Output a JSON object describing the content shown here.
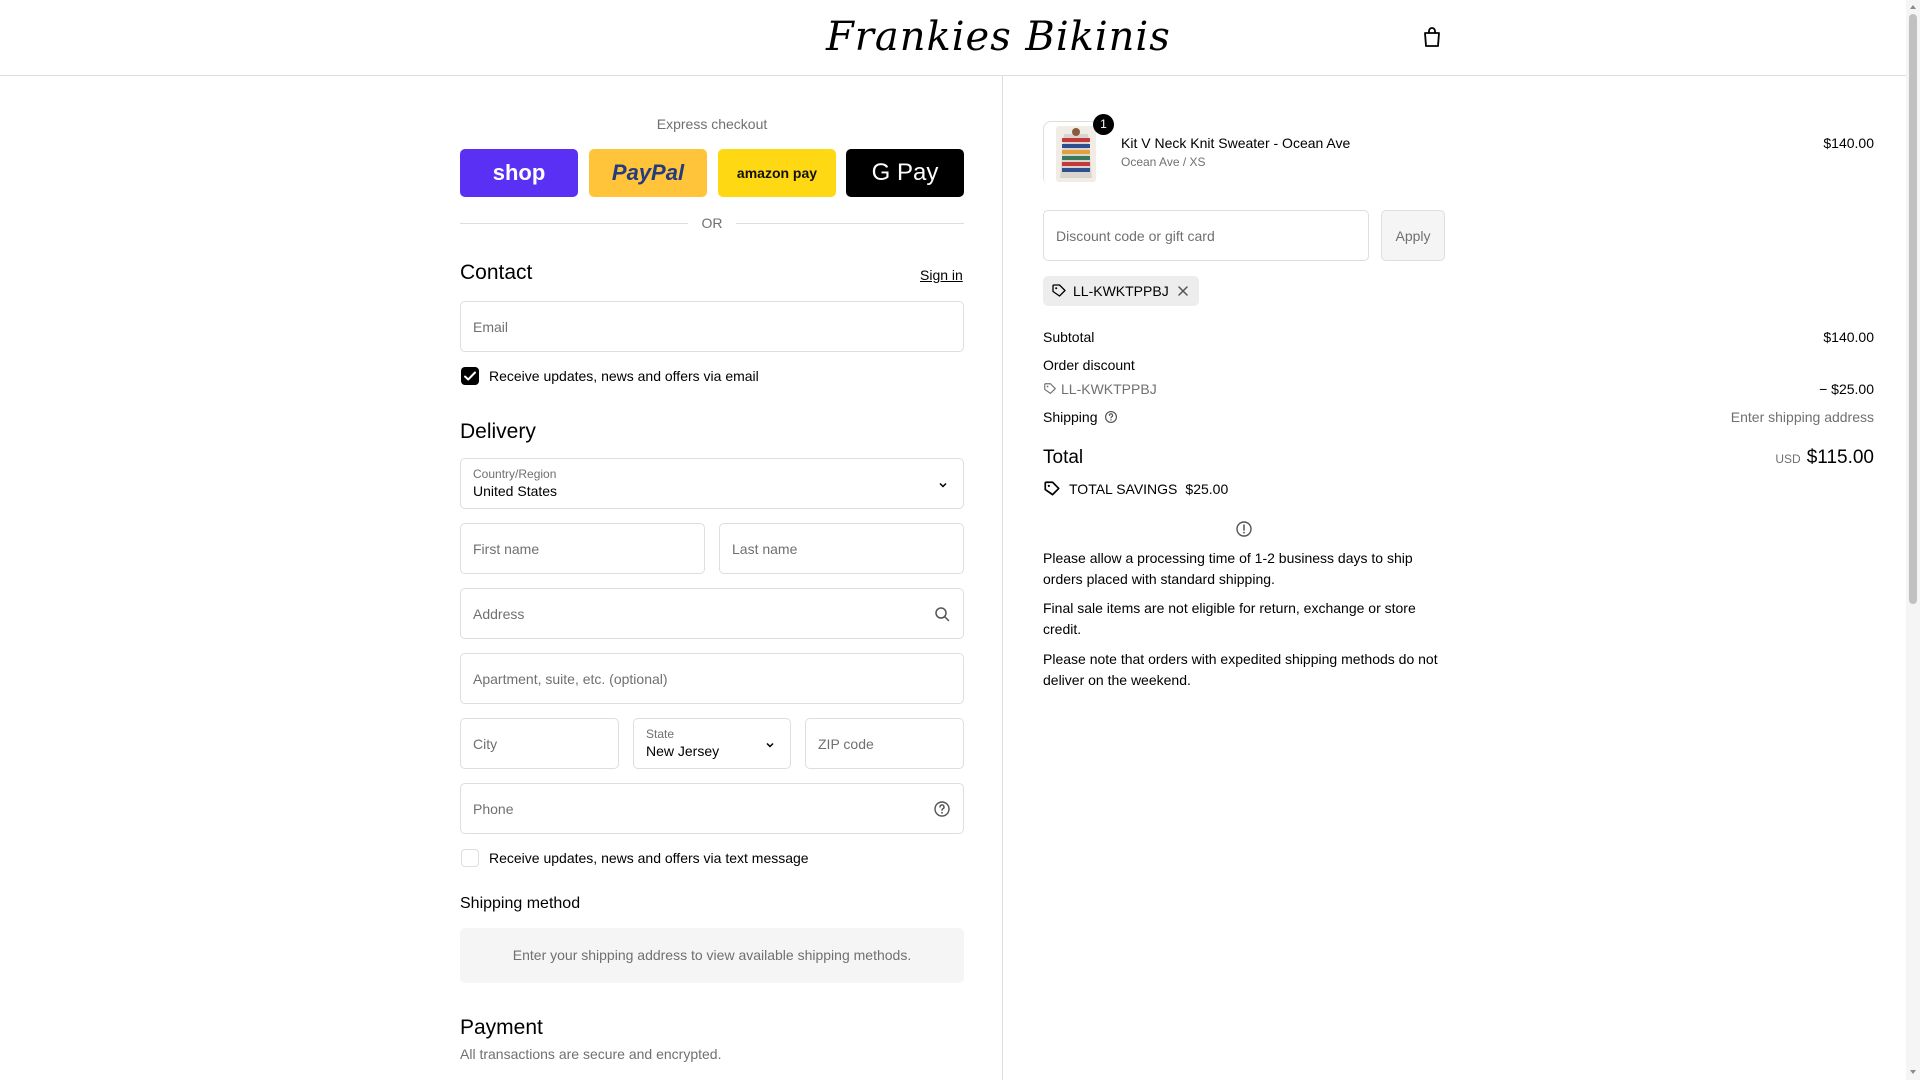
{
  "header": {
    "logo_text": "Frankies Bikinis",
    "cart_icon": "shopping-bag-icon"
  },
  "express": {
    "title": "Express checkout",
    "buttons": [
      "shop",
      "PayPal",
      "amazon pay",
      "G Pay"
    ],
    "or_text": "OR"
  },
  "contact": {
    "title": "Contact",
    "sign_in": "Sign in",
    "email_placeholder": "Email",
    "email_optin_label": "Receive updates, news and offers via email",
    "email_optin_checked": true
  },
  "delivery": {
    "title": "Delivery",
    "country_label": "Country/Region",
    "country_value": "United States",
    "first_name_placeholder": "First name",
    "last_name_placeholder": "Last name",
    "address_placeholder": "Address",
    "apartment_placeholder": "Apartment, suite, etc. (optional)",
    "city_placeholder": "City",
    "state_label": "State",
    "state_value": "New Jersey",
    "zip_placeholder": "ZIP code",
    "phone_placeholder": "Phone",
    "sms_optin_label": "Receive updates, news and offers via text message",
    "sms_optin_checked": false
  },
  "shipping_method": {
    "title": "Shipping method",
    "message": "Enter your shipping address to view available shipping methods."
  },
  "payment": {
    "title": "Payment",
    "subtitle": "All transactions are secure and encrypted."
  },
  "summary": {
    "item": {
      "quantity": "1",
      "name": "Kit V Neck Knit Sweater - Ocean Ave",
      "variant": "Ocean Ave / XS",
      "price": "$140.00"
    },
    "discount_placeholder": "Discount code or gift card",
    "apply_label": "Apply",
    "applied_code": "LL-KWKTPPBJ",
    "subtotal_label": "Subtotal",
    "subtotal_value": "$140.00",
    "order_discount_label": "Order discount",
    "discount_code": "LL-KWKTPPBJ",
    "discount_value": "− $25.00",
    "shipping_label": "Shipping",
    "shipping_value": "Enter shipping address",
    "total_label": "Total",
    "currency": "USD",
    "total_value": "$115.00",
    "savings_label": "TOTAL SAVINGS",
    "savings_value": "$25.00",
    "notices": [
      "Please allow a processing time of 1-2 business days to ship orders placed with standard shipping.",
      "Final sale items are not eligible for return, exchange or store credit.",
      "Please note that orders with expedited shipping methods do not deliver on the weekend."
    ]
  }
}
